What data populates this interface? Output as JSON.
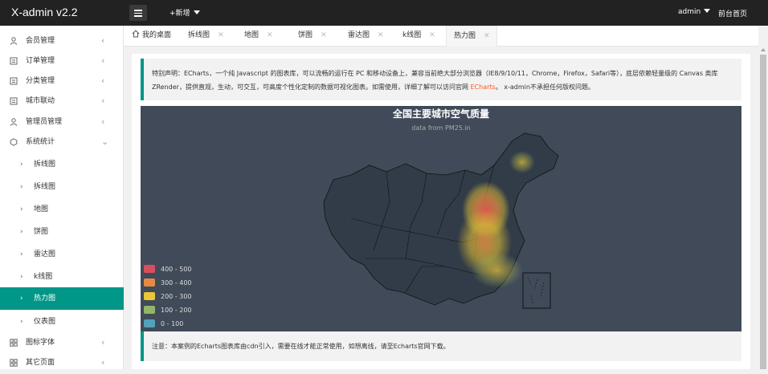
{
  "header": {
    "logo": "X-admin v2.2",
    "add_label": "+新增",
    "user": "admin",
    "front_page": "前台首页"
  },
  "sidebar": {
    "items": [
      {
        "label": "会员管理",
        "icon": "user-icon",
        "arrow": "‹"
      },
      {
        "label": "订单管理",
        "icon": "order-icon",
        "arrow": "‹"
      },
      {
        "label": "分类管理",
        "icon": "category-icon",
        "arrow": "‹"
      },
      {
        "label": "城市联动",
        "icon": "city-icon",
        "arrow": "‹"
      },
      {
        "label": "管理员管理",
        "icon": "admin-icon",
        "arrow": "‹"
      },
      {
        "label": "系统统计",
        "icon": "stats-icon",
        "arrow": "⌄"
      }
    ],
    "sub_items": [
      {
        "label": "拆线图"
      },
      {
        "label": "拆线图"
      },
      {
        "label": "地图"
      },
      {
        "label": "饼图"
      },
      {
        "label": "雷达图"
      },
      {
        "label": "k线图"
      },
      {
        "label": "热力图"
      },
      {
        "label": "仪表图"
      }
    ],
    "bottom_items": [
      {
        "label": "图标字体",
        "icon": "grid-icon",
        "arrow": "‹"
      },
      {
        "label": "其它页面",
        "icon": "grid-icon",
        "arrow": "‹"
      }
    ]
  },
  "tabs": [
    {
      "label": "我的桌面"
    },
    {
      "label": "拆线图",
      "close": "✕"
    },
    {
      "label": "地图",
      "close": "✕"
    },
    {
      "label": "饼图",
      "close": "✕"
    },
    {
      "label": "雷达图",
      "close": "✕"
    },
    {
      "label": "k线图",
      "close": "✕"
    },
    {
      "label": "热力图",
      "close": "✕"
    }
  ],
  "notice": {
    "text1": "特别声明：ECharts，一个纯 Javascript 的图表库，可以流畅的运行在 PC 和移动设备上，兼容当前绝大部分浏览器（IE8/9/10/11，Chrome，Firefox，Safari等），底层依赖轻量级的 Canvas 类库 ZRender，提供直观，生动，可交互，可高度个性化定制的数据可视化图表。如需使用，详细了解可以访问官网 ",
    "link": "ECharts",
    "text2": "。 x-admin不承担任何版权问题。"
  },
  "chart": {
    "title": "全国主要城市空气质量",
    "subtitle": "data from PM25.in",
    "legend": [
      {
        "label": "400 - 500",
        "color": "#d94e5d"
      },
      {
        "label": "300 - 400",
        "color": "#eac736"
      },
      {
        "label": "200 - 300",
        "color": "#eac736"
      },
      {
        "label": "100 - 200",
        "color": "#92b567"
      },
      {
        "label": "0 - 100",
        "color": "#50a3ba"
      }
    ],
    "colors": [
      "#d94e5d",
      "#e68a43",
      "#eac736",
      "#92b567",
      "#50a3ba"
    ]
  },
  "footer_note": "注意：本案例的Echarts图表库由cdn引入，需要在线才能正常使用，如想离线，请至Echarts官网下载。"
}
